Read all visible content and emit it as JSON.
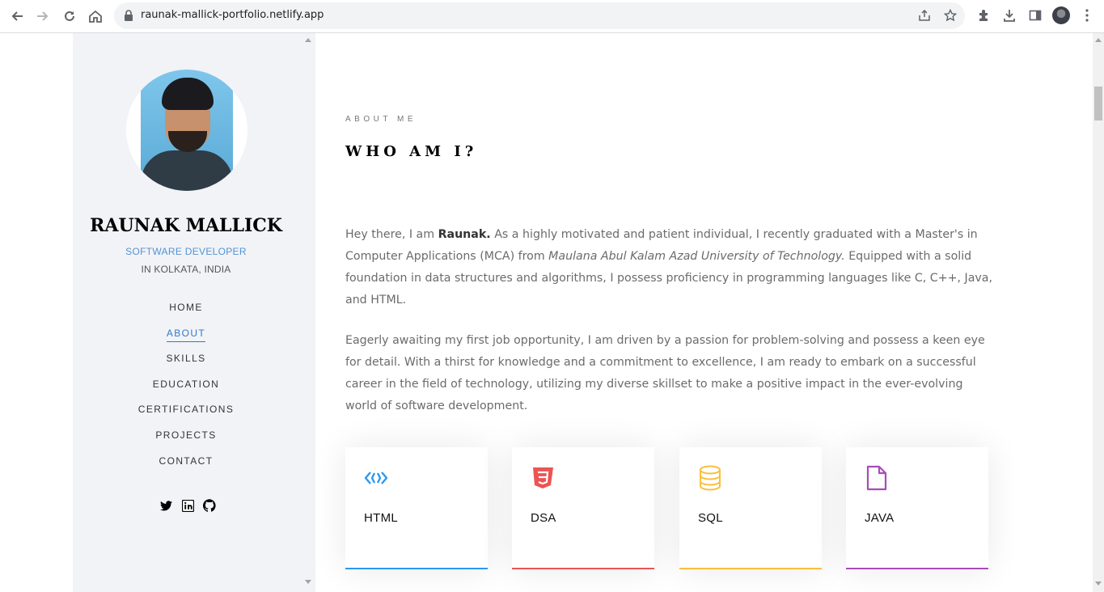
{
  "browser": {
    "url": "raunak-mallick-portfolio.netlify.app"
  },
  "profile": {
    "name": "RAUNAK MALLICK",
    "role": "SOFTWARE DEVELOPER",
    "location": "IN KOLKATA, INDIA"
  },
  "menu": {
    "items": [
      {
        "label": "HOME",
        "active": false
      },
      {
        "label": "ABOUT",
        "active": true
      },
      {
        "label": "SKILLS",
        "active": false
      },
      {
        "label": "EDUCATION",
        "active": false
      },
      {
        "label": "CERTIFICATIONS",
        "active": false
      },
      {
        "label": "PROJECTS",
        "active": false
      },
      {
        "label": "CONTACT",
        "active": false
      }
    ]
  },
  "social": [
    "twitter-icon",
    "linkedin-icon",
    "github-icon"
  ],
  "about": {
    "eyebrow": "ABOUT ME",
    "heading": "WHO AM I?",
    "p1_a": "Hey there, I am ",
    "p1_name": "Raunak.",
    "p1_b": " As a highly motivated and patient individual, I recently graduated with a Master's in Computer Applications (MCA) from ",
    "p1_univ": "Maulana Abul Kalam Azad University of Technology.",
    "p1_c": " Equipped with a solid foundation in data structures and algorithms, I possess proficiency in programming languages like C, C++, Java, and HTML.",
    "p2": "Eagerly awaiting my first job opportunity, I am driven by a passion for problem-solving and possess a keen eye for detail. With a thirst for knowledge and a commitment to excellence, I am ready to embark on a successful career in the field of technology, utilizing my diverse skillset to make a positive impact in the ever-evolving world of software development."
  },
  "cards": [
    {
      "label": "HTML",
      "icon": "code-icon",
      "color": "#2c98f0"
    },
    {
      "label": "DSA",
      "icon": "css3-icon",
      "color": "#ec5453"
    },
    {
      "label": "SQL",
      "icon": "database-icon",
      "color": "#f9bf3f"
    },
    {
      "label": "JAVA",
      "icon": "file-icon",
      "color": "#a84cb8"
    }
  ]
}
